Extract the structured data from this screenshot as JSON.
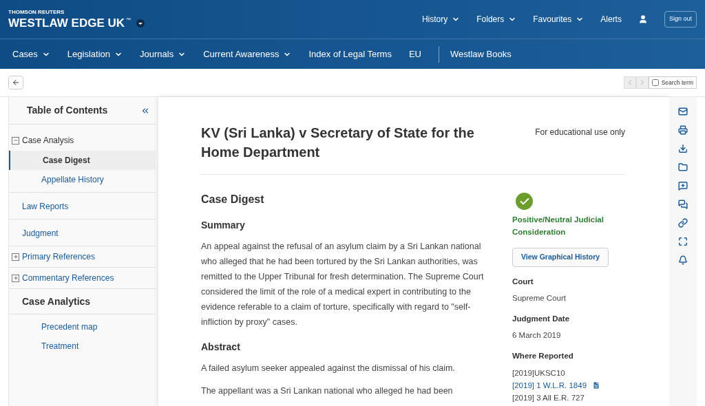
{
  "header": {
    "brand_top": "THOMSON REUTERS",
    "brand": "WESTLAW EDGE UK",
    "brand_mark": "™",
    "menu": [
      {
        "label": "History",
        "dropdown": true
      },
      {
        "label": "Folders",
        "dropdown": true
      },
      {
        "label": "Favourites",
        "dropdown": true
      },
      {
        "label": "Alerts",
        "dropdown": false
      }
    ],
    "sign_out": "Sign out"
  },
  "nav": [
    {
      "label": "Cases",
      "dropdown": true,
      "divider_before": false
    },
    {
      "label": "Legislation",
      "dropdown": true,
      "divider_before": false
    },
    {
      "label": "Journals",
      "dropdown": true,
      "divider_before": false
    },
    {
      "label": "Current Awareness",
      "dropdown": true,
      "divider_before": false
    },
    {
      "label": "Index of Legal Terms",
      "dropdown": false,
      "divider_before": false
    },
    {
      "label": "EU",
      "dropdown": false,
      "divider_before": false
    },
    {
      "label": "Westlaw Books",
      "dropdown": false,
      "divider_before": true
    }
  ],
  "toolbar": {
    "search_term": {
      "label": "Search term",
      "checked": false
    }
  },
  "toc": {
    "title": "Table of Contents",
    "items": [
      {
        "kind": "group",
        "label": "Case Analysis",
        "expanded": true,
        "children": [
          {
            "label": "Case Digest",
            "selected": true
          },
          {
            "label": "Appellate History",
            "selected": false
          }
        ]
      },
      {
        "kind": "link",
        "label": "Law Reports"
      },
      {
        "kind": "link",
        "label": "Judgment"
      },
      {
        "kind": "group",
        "label": "Primary References",
        "expanded": false
      },
      {
        "kind": "group",
        "label": "Commentary References",
        "expanded": false
      },
      {
        "kind": "heading",
        "label": "Case Analytics",
        "children": [
          {
            "label": "Precedent map",
            "selected": false
          },
          {
            "label": "Treatment",
            "selected": false
          }
        ]
      }
    ]
  },
  "document": {
    "title": "KV (Sri Lanka) v Secretary of State for the Home Department",
    "notice": "For educational use only",
    "heading": "Case Digest",
    "sections": [
      {
        "heading": "Summary",
        "paragraphs": [
          "An appeal against the refusal of an asylum claim by a Sri Lankan national who alleged that he had been tortured by the Sri Lankan authorities, was remitted to the Upper Tribunal for fresh determination. The Supreme Court considered the limit of the role of a medical expert in contributing to the evidence referable to a claim of torture, specifically with regard to \"self-infliction by proxy\" cases."
        ]
      },
      {
        "heading": "Abstract",
        "paragraphs": [
          "A failed asylum seeker appealed against the dismissal of his claim.",
          "The appellant was a Sri Lankan national who alleged he had been"
        ]
      }
    ]
  },
  "details": {
    "status": {
      "label": "Positive/Neutral Judicial Consideration",
      "color": "#6b9e2f"
    },
    "button": "View Graphical History",
    "fields": [
      {
        "label": "Court",
        "values": [
          {
            "text": "Supreme Court",
            "link": false,
            "pdf": false
          }
        ]
      },
      {
        "label": "Judgment Date",
        "values": [
          {
            "text": "6 March 2019",
            "link": false,
            "pdf": false
          }
        ]
      },
      {
        "label": "Where Reported",
        "values": [
          {
            "text": "[2019]UKSC10",
            "link": false,
            "pdf": false
          },
          {
            "text": "[2019] 1 W.L.R. 1849",
            "link": true,
            "pdf": true
          },
          {
            "text": "[2019] 3 All E.R. 727",
            "link": false,
            "pdf": false
          }
        ]
      }
    ]
  }
}
